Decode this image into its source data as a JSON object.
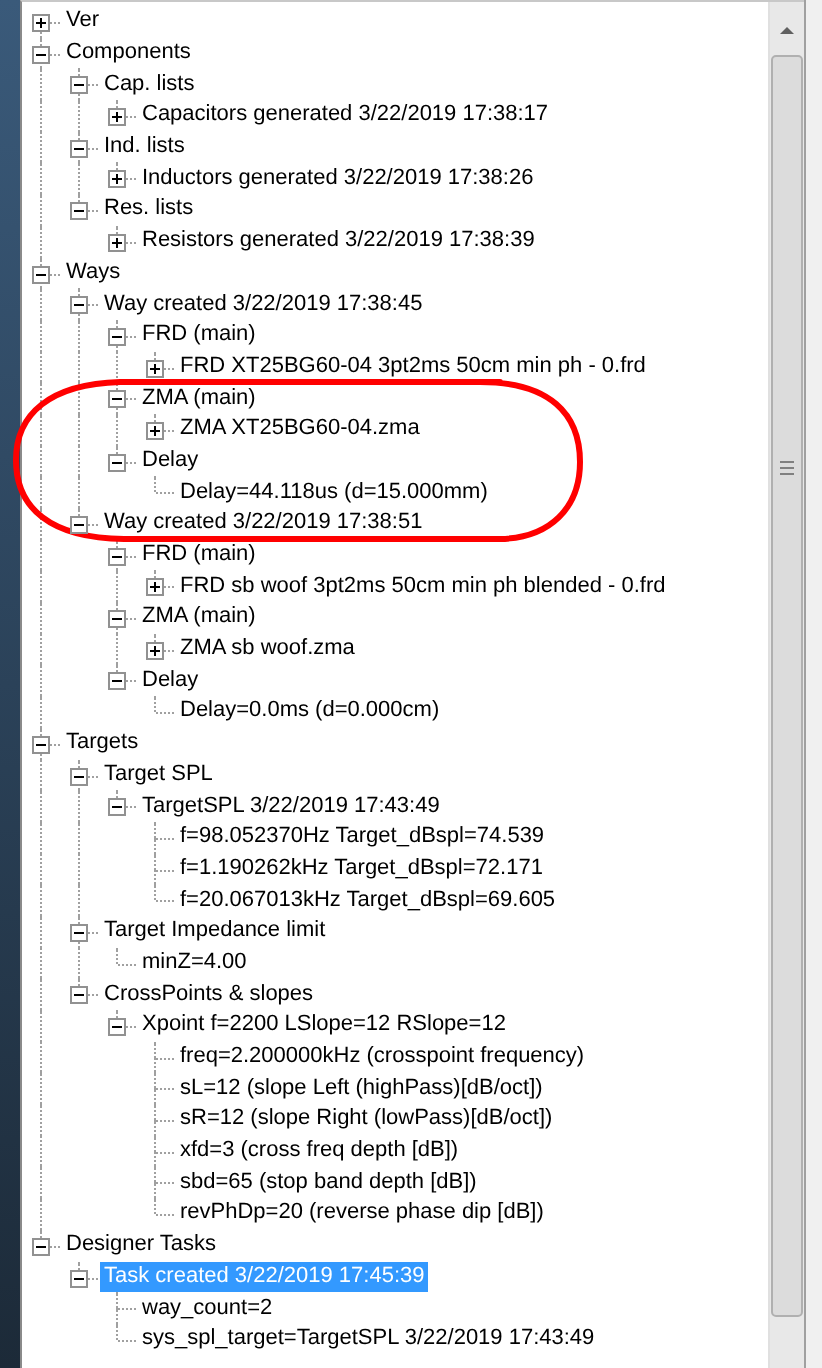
{
  "tree": [
    {
      "label": "Ver",
      "kind": "folder",
      "expanded": false,
      "selected": false
    },
    {
      "label": "Components",
      "kind": "folder",
      "expanded": true,
      "selected": false,
      "children": [
        {
          "label": "Cap. lists",
          "kind": "folder",
          "expanded": true,
          "selected": false,
          "children": [
            {
              "label": "Capacitors generated 3/22/2019 17:38:17",
              "kind": "folder",
              "expanded": false,
              "selected": false
            }
          ]
        },
        {
          "label": "Ind. lists",
          "kind": "folder",
          "expanded": true,
          "selected": false,
          "children": [
            {
              "label": "Inductors generated 3/22/2019 17:38:26",
              "kind": "folder",
              "expanded": false,
              "selected": false
            }
          ]
        },
        {
          "label": "Res. lists",
          "kind": "folder",
          "expanded": true,
          "selected": false,
          "children": [
            {
              "label": "Resistors generated 3/22/2019 17:38:39",
              "kind": "folder",
              "expanded": false,
              "selected": false
            }
          ]
        }
      ]
    },
    {
      "label": "Ways",
      "kind": "folder",
      "expanded": true,
      "selected": false,
      "children": [
        {
          "label": "Way created 3/22/2019 17:38:45",
          "kind": "folder",
          "expanded": true,
          "selected": false,
          "children": [
            {
              "label": "FRD (main)",
              "kind": "folder",
              "expanded": true,
              "selected": false,
              "children": [
                {
                  "label": "FRD XT25BG60-04 3pt2ms 50cm min ph - 0.frd",
                  "kind": "folder",
                  "expanded": false,
                  "selected": false
                }
              ]
            },
            {
              "label": "ZMA (main)",
              "kind": "folder",
              "expanded": true,
              "selected": false,
              "children": [
                {
                  "label": "ZMA XT25BG60-04.zma",
                  "kind": "folder",
                  "expanded": false,
                  "selected": false
                }
              ]
            },
            {
              "label": "Delay",
              "kind": "folder",
              "expanded": true,
              "selected": false,
              "children": [
                {
                  "label": "Delay=44.118us (d=15.000mm)",
                  "kind": "leaf",
                  "selected": false
                }
              ]
            }
          ]
        },
        {
          "label": "Way created 3/22/2019 17:38:51",
          "kind": "folder",
          "expanded": true,
          "selected": false,
          "children": [
            {
              "label": "FRD (main)",
              "kind": "folder",
              "expanded": true,
              "selected": false,
              "children": [
                {
                  "label": "FRD sb woof 3pt2ms 50cm min ph blended - 0.frd",
                  "kind": "folder",
                  "expanded": false,
                  "selected": false
                }
              ]
            },
            {
              "label": "ZMA (main)",
              "kind": "folder",
              "expanded": true,
              "selected": false,
              "children": [
                {
                  "label": "ZMA sb woof.zma",
                  "kind": "folder",
                  "expanded": false,
                  "selected": false
                }
              ]
            },
            {
              "label": "Delay",
              "kind": "folder",
              "expanded": true,
              "selected": false,
              "children": [
                {
                  "label": "Delay=0.0ms (d=0.000cm)",
                  "kind": "leaf",
                  "selected": false
                }
              ]
            }
          ]
        }
      ]
    },
    {
      "label": "Targets",
      "kind": "folder",
      "expanded": true,
      "selected": false,
      "children": [
        {
          "label": "Target SPL",
          "kind": "folder",
          "expanded": true,
          "selected": false,
          "children": [
            {
              "label": "TargetSPL 3/22/2019 17:43:49",
              "kind": "folder",
              "expanded": true,
              "selected": false,
              "children": [
                {
                  "label": "f=98.052370Hz Target_dBspl=74.539",
                  "kind": "leaf",
                  "selected": false
                },
                {
                  "label": "f=1.190262kHz Target_dBspl=72.171",
                  "kind": "leaf",
                  "selected": false
                },
                {
                  "label": "f=20.067013kHz Target_dBspl=69.605",
                  "kind": "leaf",
                  "selected": false
                }
              ]
            }
          ]
        },
        {
          "label": "Target Impedance limit",
          "kind": "folder",
          "expanded": true,
          "selected": false,
          "children": [
            {
              "label": "minZ=4.00",
              "kind": "leaf",
              "selected": false
            }
          ]
        },
        {
          "label": "CrossPoints & slopes",
          "kind": "folder",
          "expanded": true,
          "selected": false,
          "children": [
            {
              "label": "Xpoint f=2200  LSlope=12  RSlope=12",
              "kind": "folder",
              "expanded": true,
              "selected": false,
              "children": [
                {
                  "label": "freq=2.200000kHz (crosspoint frequency)",
                  "kind": "leaf",
                  "selected": false
                },
                {
                  "label": "sL=12 (slope Left (highPass)[dB/oct])",
                  "kind": "leaf",
                  "selected": false
                },
                {
                  "label": "sR=12 (slope Right (lowPass)[dB/oct])",
                  "kind": "leaf",
                  "selected": false
                },
                {
                  "label": "xfd=3 (cross freq depth [dB])",
                  "kind": "leaf",
                  "selected": false
                },
                {
                  "label": "sbd=65 (stop band depth [dB])",
                  "kind": "leaf",
                  "selected": false
                },
                {
                  "label": "revPhDp=20 (reverse phase dip [dB])",
                  "kind": "leaf",
                  "selected": false
                }
              ]
            }
          ]
        }
      ]
    },
    {
      "label": "Designer Tasks",
      "kind": "folder",
      "expanded": true,
      "selected": false,
      "children": [
        {
          "label": "Task created 3/22/2019 17:45:39",
          "kind": "folder",
          "expanded": true,
          "selected": true,
          "children": [
            {
              "label": "way_count=2",
              "kind": "leaf",
              "selected": false
            },
            {
              "label": "sys_spl_target=TargetSPL 3/22/2019 17:43:49",
              "kind": "leaf",
              "selected": false
            }
          ]
        }
      ]
    }
  ],
  "annotations": [
    {
      "kind": "ellipse",
      "color": "#ff0000"
    }
  ]
}
